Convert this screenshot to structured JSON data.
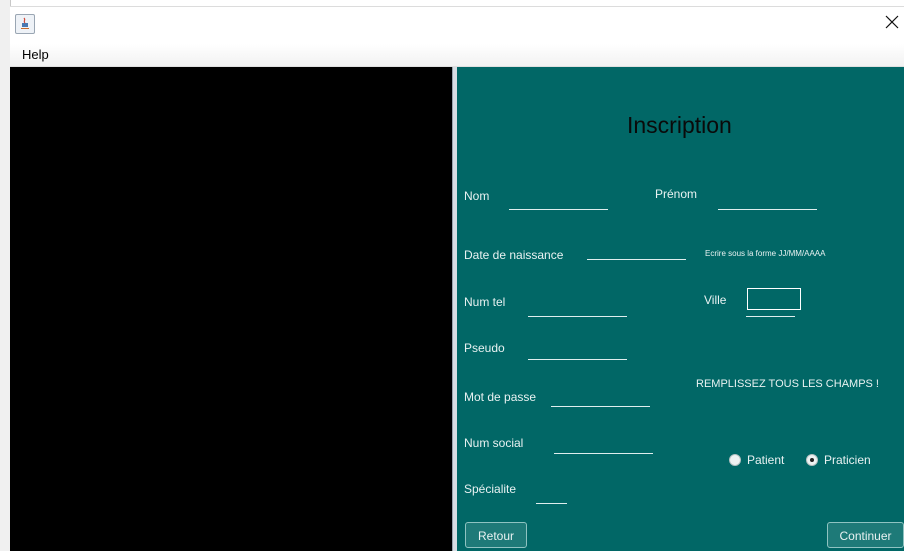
{
  "window": {
    "menu": [
      "Help"
    ]
  },
  "form": {
    "title": "Inscription",
    "labels": {
      "nom": "Nom",
      "prenom": "Prénom",
      "date_naissance": "Date de naissance",
      "date_hint": "Ecrire sous la forme JJ/MM/AAAA",
      "num_tel": "Num tel",
      "ville": "Ville",
      "pseudo": "Pseudo",
      "mot_de_passe": "Mot de passe",
      "num_social": "Num social",
      "specialite": "Spécialite"
    },
    "fields": {
      "nom": "",
      "prenom": "",
      "date_naissance": "",
      "num_tel": "",
      "ville": "",
      "pseudo": "",
      "mot_de_passe": "",
      "num_social": "",
      "specialite": ""
    },
    "warning": "REMPLISSEZ TOUS LES CHAMPS !",
    "role_options": [
      {
        "label": "Patient",
        "selected": false
      },
      {
        "label": "Praticien",
        "selected": true
      }
    ],
    "buttons": {
      "back": "Retour",
      "continue": "Continuer"
    }
  },
  "colors": {
    "panel": "#016766",
    "text": "#e9f2f2",
    "left_panel": "#000000"
  },
  "icons": {
    "app": "java-app-icon",
    "close": "close-icon"
  }
}
